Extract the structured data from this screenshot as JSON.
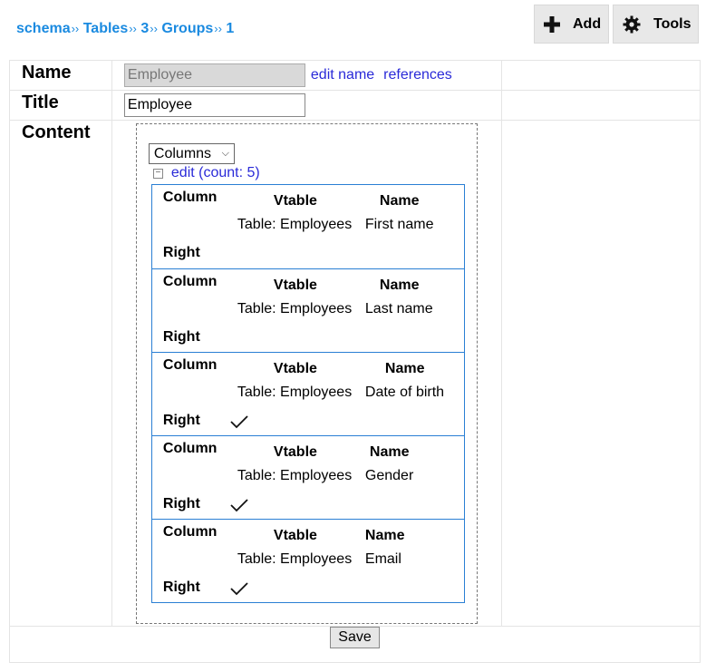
{
  "breadcrumb": [
    {
      "label": "schema"
    },
    {
      "label": "Tables"
    },
    {
      "label": "3"
    },
    {
      "label": "Groups"
    },
    {
      "label": "1"
    }
  ],
  "breadcrumb_separator": "››",
  "toolbar": {
    "add_label": "Add",
    "tools_label": "Tools"
  },
  "form": {
    "name_label": "Name",
    "name_value": "Employee",
    "edit_name_link": "edit name",
    "references_link": "references",
    "title_label": "Title",
    "title_value": "Employee",
    "content_label": "Content"
  },
  "content": {
    "select_value": "Columns",
    "edit_link": "edit (count: 5)",
    "column_header": "Column",
    "vtable_header": "Vtable",
    "name_header": "Name",
    "right_header": "Right",
    "items": [
      {
        "vtable": "Table: Employees",
        "name": "First name",
        "right": false
      },
      {
        "vtable": "Table: Employees",
        "name": "Last name",
        "right": false
      },
      {
        "vtable": "Table: Employees",
        "name": "Date of birth",
        "right": true
      },
      {
        "vtable": "Table: Employees",
        "name": "Gender",
        "right": true
      },
      {
        "vtable": "Table: Employees",
        "name": "Email",
        "right": true
      }
    ]
  },
  "save_label": "Save"
}
